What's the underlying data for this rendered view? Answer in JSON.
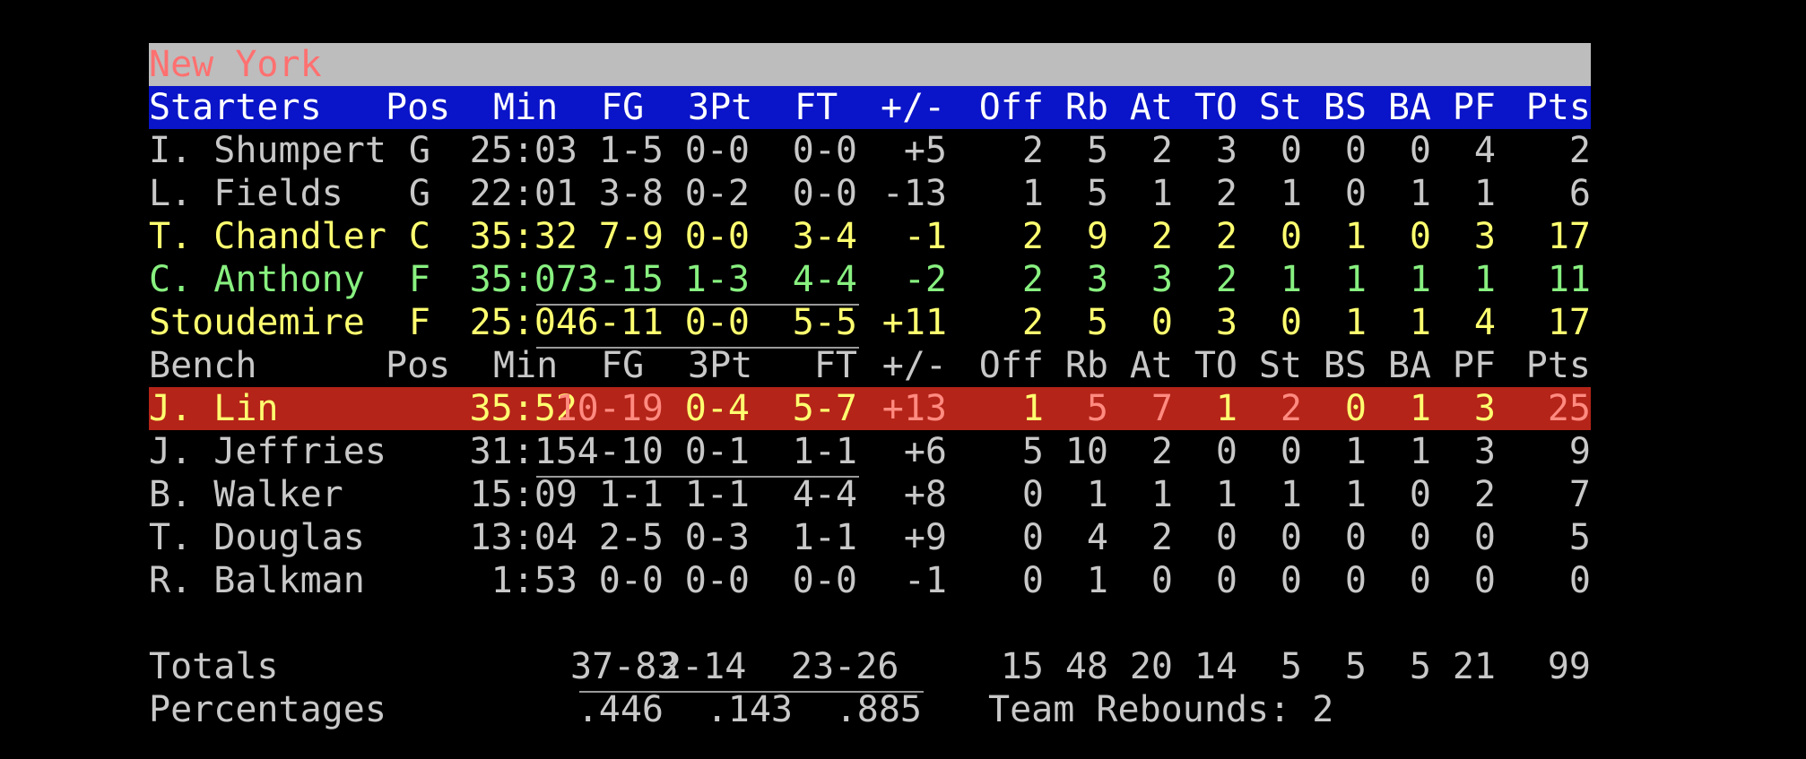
{
  "team": "New York",
  "starters_header": {
    "label": "Starters",
    "cols": [
      "Pos",
      "Min",
      "FG",
      "3Pt",
      "FT",
      "+/-",
      "Off",
      "Rb",
      "At",
      "TO",
      "St",
      "BS",
      "BA",
      "PF",
      "Pts"
    ]
  },
  "bench_header": {
    "label": "Bench",
    "cols": [
      "Pos",
      "Min",
      "FG",
      "3Pt",
      "FT",
      "+/-",
      "Off",
      "Rb",
      "At",
      "TO",
      "St",
      "BS",
      "BA",
      "PF",
      "Pts"
    ]
  },
  "starters": [
    {
      "name": "I. Shumpert",
      "pos": "G",
      "min": "25:03",
      "fg": "1-5",
      "tp": "0-0",
      "ft": "0-0",
      "pm": "+5",
      "off": "2",
      "rb": "5",
      "at": "2",
      "to": "3",
      "st": "0",
      "bs": "0",
      "ba": "0",
      "pf": "4",
      "pts": "2"
    },
    {
      "name": "L. Fields",
      "pos": "G",
      "min": "22:01",
      "fg": "3-8",
      "tp": "0-2",
      "ft": "0-0",
      "pm": "-13",
      "off": "1",
      "rb": "5",
      "at": "1",
      "to": "2",
      "st": "1",
      "bs": "0",
      "ba": "1",
      "pf": "1",
      "pts": "6"
    },
    {
      "name": "T. Chandler",
      "pos": "C",
      "min": "35:32",
      "fg": "7-9",
      "tp": "0-0",
      "ft": "3-4",
      "pm": "-1",
      "off": "2",
      "rb": "9",
      "at": "2",
      "to": "2",
      "st": "0",
      "bs": "1",
      "ba": "0",
      "pf": "3",
      "pts": "17"
    },
    {
      "name": "C. Anthony",
      "pos": "F",
      "min": "35:07",
      "fg": "3-15",
      "tp": "1-3",
      "ft": "4-4",
      "pm": "-2",
      "off": "2",
      "rb": "3",
      "at": "3",
      "to": "2",
      "st": "1",
      "bs": "1",
      "ba": "1",
      "pf": "1",
      "pts": "11"
    },
    {
      "name": "Stoudemire",
      "pos": "F",
      "min": "25:04",
      "fg": "6-11",
      "tp": "0-0",
      "ft": "5-5",
      "pm": "+11",
      "off": "2",
      "rb": "5",
      "at": "0",
      "to": "3",
      "st": "0",
      "bs": "1",
      "ba": "1",
      "pf": "4",
      "pts": "17"
    }
  ],
  "bench": [
    {
      "name": "J. Lin",
      "pos": "",
      "min": "35:52",
      "fg": "10-19",
      "tp": "0-4",
      "ft": "5-7",
      "pm": "+13",
      "off": "1",
      "rb": "5",
      "at": "7",
      "to": "1",
      "st": "2",
      "bs": "0",
      "ba": "1",
      "pf": "3",
      "pts": "25"
    },
    {
      "name": "J. Jeffries",
      "pos": "",
      "min": "31:15",
      "fg": "4-10",
      "tp": "0-1",
      "ft": "1-1",
      "pm": "+6",
      "off": "5",
      "rb": "10",
      "at": "2",
      "to": "0",
      "st": "0",
      "bs": "1",
      "ba": "1",
      "pf": "3",
      "pts": "9"
    },
    {
      "name": "B. Walker",
      "pos": "",
      "min": "15:09",
      "fg": "1-1",
      "tp": "1-1",
      "ft": "4-4",
      "pm": "+8",
      "off": "0",
      "rb": "1",
      "at": "1",
      "to": "1",
      "st": "1",
      "bs": "1",
      "ba": "0",
      "pf": "2",
      "pts": "7"
    },
    {
      "name": "T. Douglas",
      "pos": "",
      "min": "13:04",
      "fg": "2-5",
      "tp": "0-3",
      "ft": "1-1",
      "pm": "+9",
      "off": "0",
      "rb": "4",
      "at": "2",
      "to": "0",
      "st": "0",
      "bs": "0",
      "ba": "0",
      "pf": "0",
      "pts": "5"
    },
    {
      "name": "R. Balkman",
      "pos": "",
      "min": "1:53",
      "fg": "0-0",
      "tp": "0-0",
      "ft": "0-0",
      "pm": "-1",
      "off": "0",
      "rb": "1",
      "at": "0",
      "to": "0",
      "st": "0",
      "bs": "0",
      "ba": "0",
      "pf": "0",
      "pts": "0"
    }
  ],
  "totals": {
    "label": "Totals",
    "fg": "37-83",
    "tp": "2-14",
    "ft": "23-26",
    "off": "15",
    "rb": "48",
    "at": "20",
    "to": "14",
    "st": "5",
    "bs": "5",
    "ba": "5",
    "pf": "21",
    "pts": "99"
  },
  "percentages": {
    "label": "Percentages",
    "fg": ".446",
    "tp": ".143",
    "ft": ".885",
    "team_rebounds": "Team Rebounds: 2"
  },
  "colors": {
    "background": "#000000",
    "title_bar": "#bdbdbd",
    "header_bar": "#0a14c8",
    "highlight_row": "#b42418",
    "default_text": "#c8c8c8",
    "yellow_text": "#ffff70",
    "green_text": "#88f080",
    "pink_text": "#ff8a80"
  }
}
